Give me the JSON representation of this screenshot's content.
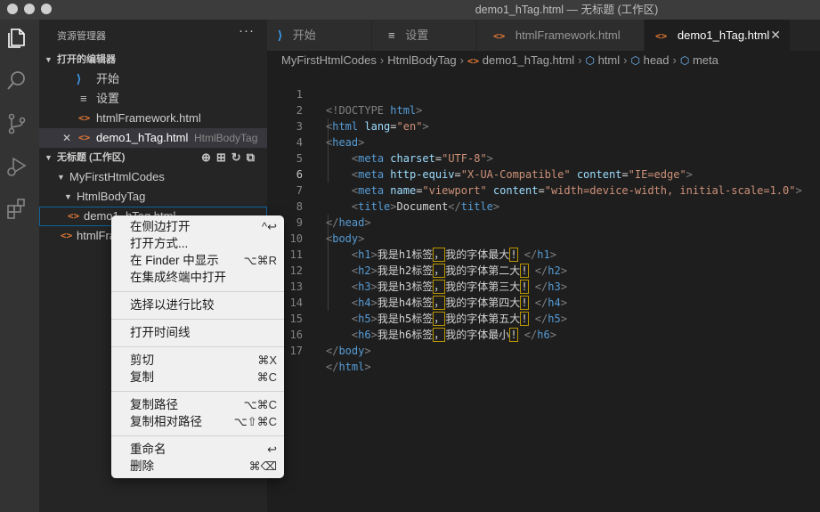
{
  "window": {
    "title": "demo1_hTag.html — 无标题 (工作区)"
  },
  "activity_bar": [
    "explorer-icon",
    "search-icon",
    "source-control-icon",
    "run-debug-icon",
    "extensions-icon"
  ],
  "sidebar": {
    "header": "资源管理器",
    "more": "···",
    "open_editors": {
      "title": "打开的编辑器",
      "items": [
        {
          "label": "开始",
          "icon": "vscode-icon"
        },
        {
          "label": "设置",
          "icon": "settings-icon"
        },
        {
          "label": "htmlFramework.html",
          "icon": "html-file-icon"
        },
        {
          "label": "demo1_hTag.html",
          "icon": "html-file-icon",
          "desc": "HtmlBodyTag",
          "close": "✕"
        }
      ]
    },
    "workspace": {
      "title": "无标题 (工作区)",
      "tree": [
        {
          "label": "MyFirstHtmlCodes"
        },
        {
          "label": "HtmlBodyTag"
        },
        {
          "label": "demo1_hTag.html"
        },
        {
          "label": "htmlFramework.html"
        }
      ]
    }
  },
  "tabs": [
    {
      "label": "开始"
    },
    {
      "label": "设置"
    },
    {
      "label": "htmlFramework.html"
    },
    {
      "label": "demo1_hTag.html",
      "close": "✕"
    }
  ],
  "breadcrumbs": [
    "MyFirstHtmlCodes",
    "HtmlBodyTag",
    "demo1_hTag.html",
    "html",
    "head",
    "meta"
  ],
  "editor": {
    "current_line": 6,
    "line_numbers": [
      "1",
      "2",
      "3",
      "4",
      "5",
      "6",
      "7",
      "8",
      "9",
      "10",
      "11",
      "12",
      "13",
      "14",
      "15",
      "16",
      "17"
    ],
    "tokens": {
      "doctype": "<!DOCTYPE ",
      "doctype_name": "html",
      "html": "html",
      "head": "head",
      "meta": "meta",
      "title_tag": "title",
      "body": "body",
      "lang": "lang",
      "lang_val": "\"en\"",
      "charset": "charset",
      "charset_val": "\"UTF-8\"",
      "http_equiv": "http-equiv",
      "http_equiv_val": "\"X-UA-Compatible\"",
      "content": "content",
      "content_val_1": "\"IE=edge\"",
      "name": "name",
      "name_val": "\"viewport\"",
      "content_val_2": "\"width=device-width, initial-scale=1.0\"",
      "title_text": "Document"
    },
    "headings": [
      {
        "tag": "h1",
        "pre": "我是h1标签",
        "comma": "，",
        "post": "我的字体最大",
        "ex": "!"
      },
      {
        "tag": "h2",
        "pre": "我是h2标签",
        "comma": "，",
        "post": "我的字体第二大",
        "ex": "!"
      },
      {
        "tag": "h3",
        "pre": "我是h3标签",
        "comma": "，",
        "post": "我的字体第三大",
        "ex": "!"
      },
      {
        "tag": "h4",
        "pre": "我是h4标签",
        "comma": "，",
        "post": "我的字体第四大",
        "ex": "!"
      },
      {
        "tag": "h5",
        "pre": "我是h5标签",
        "comma": "，",
        "post": "我的字体第五大",
        "ex": "!"
      },
      {
        "tag": "h6",
        "pre": "我是h6标签",
        "comma": "，",
        "post": "我的字体最小",
        "ex": "!"
      }
    ]
  },
  "context_menu": [
    {
      "label": "在侧边打开",
      "shortcut": "^↩"
    },
    {
      "label": "打开方式...",
      "shortcut": ""
    },
    {
      "label": "在 Finder 中显示",
      "shortcut": "⌥⌘R"
    },
    {
      "label": "在集成终端中打开",
      "shortcut": ""
    },
    {
      "label": "选择以进行比较",
      "shortcut": ""
    },
    {
      "label": "打开时间线",
      "shortcut": ""
    },
    {
      "label": "剪切",
      "shortcut": "⌘X"
    },
    {
      "label": "复制",
      "shortcut": "⌘C"
    },
    {
      "label": "复制路径",
      "shortcut": "⌥⌘C"
    },
    {
      "label": "复制相对路径",
      "shortcut": "⌥⇧⌘C"
    },
    {
      "label": "重命名",
      "shortcut": "↩"
    },
    {
      "label": "删除",
      "shortcut": "⌘⌫"
    }
  ]
}
